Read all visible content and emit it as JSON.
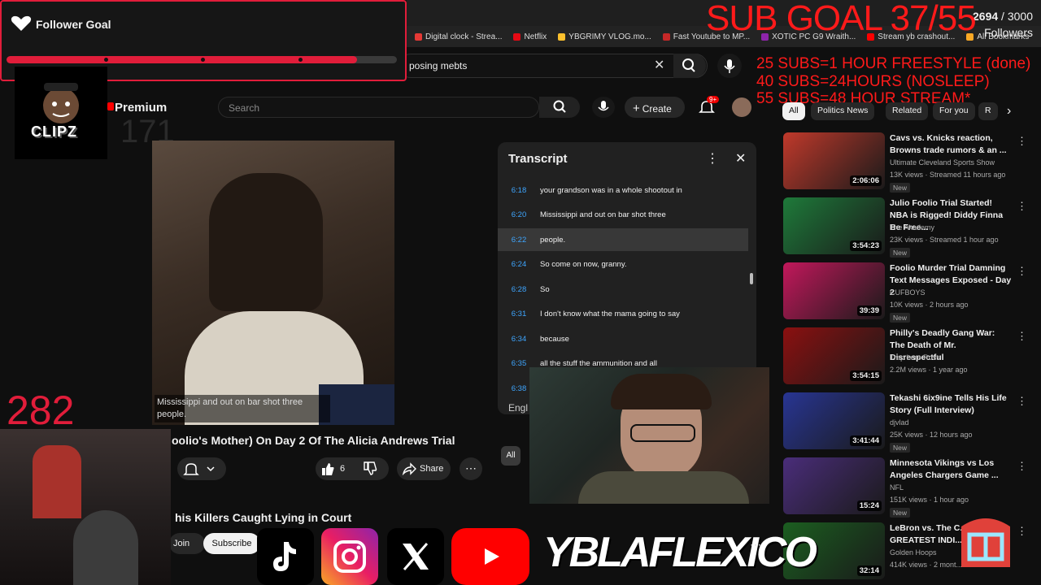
{
  "browser": {
    "bookmarks": [
      {
        "label": "Digital clock - Strea...",
        "color": "#e53935"
      },
      {
        "label": "Netflix",
        "color": "#e50914"
      },
      {
        "label": "YBGRIMY VLOG.mo...",
        "color": "#fbc02d"
      },
      {
        "label": "Fast Youtube to MP...",
        "color": "#c62828"
      },
      {
        "label": "XOTIC PC G9 Wraith...",
        "color": "#8e24aa"
      },
      {
        "label": "Stream yb crashout...",
        "color": "#ff0000"
      },
      {
        "label": "All Bookmarks",
        "color": "#f9a825"
      }
    ],
    "search_value": "posing mebts"
  },
  "follower_goal": {
    "title": "Follower Goal",
    "current": "2694",
    "separator": " / ",
    "target": "3000",
    "unit": "Followers",
    "progress": 0.898,
    "accent": "#e11d3a"
  },
  "sub_goal": {
    "headline": "SUB GOAL 37/55",
    "lines": [
      "25 SUBS=1 HOUR FREESTYLE (done)",
      "40 SUBS=24HOURS (NOSLEEP)",
      "55 SUBS=48 HOUR STREAM*"
    ]
  },
  "counters": {
    "left": "282",
    "ghost": "171"
  },
  "inner_youtube": {
    "premium_label": "Premium",
    "search_placeholder": "Search",
    "create_label": "Create",
    "notif_badge": "9+",
    "video_subtitle": "Mississippi and out on bar shot three people.",
    "video_title": "oolio's Mother) On Day 2 Of The Alicia Andrews Trial",
    "like_count": "6",
    "share_label": "Share",
    "next_title": "his Killers Caught Lying in Court",
    "join_label": "Join",
    "subscribe_label": "Subscribe",
    "all_chip": "All"
  },
  "transcript": {
    "title": "Transcript",
    "language": "Engl",
    "rows": [
      {
        "time": "6:18",
        "text": "your grandson was in a whole shootout in",
        "active": false
      },
      {
        "time": "6:20",
        "text": "Mississippi and out on bar shot three",
        "active": false
      },
      {
        "time": "6:22",
        "text": "people.",
        "active": true
      },
      {
        "time": "6:24",
        "text": "So come on now, granny.",
        "active": false
      },
      {
        "time": "6:28",
        "text": "So",
        "active": false
      },
      {
        "time": "6:31",
        "text": "I don't know what the mama going to say",
        "active": false
      },
      {
        "time": "6:34",
        "text": "because",
        "active": false
      },
      {
        "time": "6:35",
        "text": "all the stuff the ammunition and all",
        "active": false
      },
      {
        "time": "6:38",
        "text": "",
        "active": false
      }
    ]
  },
  "chips": [
    "All",
    "Politics News",
    "Related",
    "For you",
    "R"
  ],
  "feed": [
    {
      "title": "Cavs vs. Knicks reaction, Browns trade rumors & an ...",
      "channel": "Ultimate Cleveland Sports Show",
      "meta": "13K views · Streamed 11 hours ago",
      "badge": "New",
      "duration": "2:06:06",
      "color": "#c0392b"
    },
    {
      "title": "Julio Foolio Trial Started! NBA is Rigged! Diddy Finna Be Free...",
      "channel": "The Akademy",
      "meta": "23K views · Streamed 1 hour ago",
      "badge": "New",
      "duration": "3:54:23",
      "color": "#1e7a3a"
    },
    {
      "title": "Foolio Murder Trial Damning Text Messages Exposed - Day 2",
      "channel": "CUFBOYS",
      "meta": "10K views · 2 hours ago",
      "badge": "New",
      "duration": "39:39",
      "color": "#c2185b"
    },
    {
      "title": "Philly's Deadly Gang War: The Death of Mr. Disrespectful",
      "channel": "Trap Lore Ross",
      "meta": "2.2M views · 1 year ago",
      "badge": "",
      "duration": "3:54:15",
      "color": "#8b1010"
    },
    {
      "title": "Tekashi 6ix9ine Tells His Life Story (Full Interview)",
      "channel": "djvlad",
      "meta": "25K views · 12 hours ago",
      "badge": "New",
      "duration": "3:41:44",
      "color": "#283593"
    },
    {
      "title": "Minnesota Vikings vs Los Angeles Chargers Game ...",
      "channel": "NFL",
      "meta": "151K views · 1 hour ago",
      "badge": "New",
      "duration": "15:24",
      "color": "#4a2d7a"
    },
    {
      "title": "LeBron vs. The C... GREATEST INDI...",
      "channel": "Golden Hoops",
      "meta": "414K views · 2 mont...",
      "badge": "",
      "duration": "32:14",
      "color": "#1b5e20"
    }
  ],
  "overlay": {
    "handle": "YBLAFLEXICO",
    "logo_text": "CLIPZ"
  }
}
